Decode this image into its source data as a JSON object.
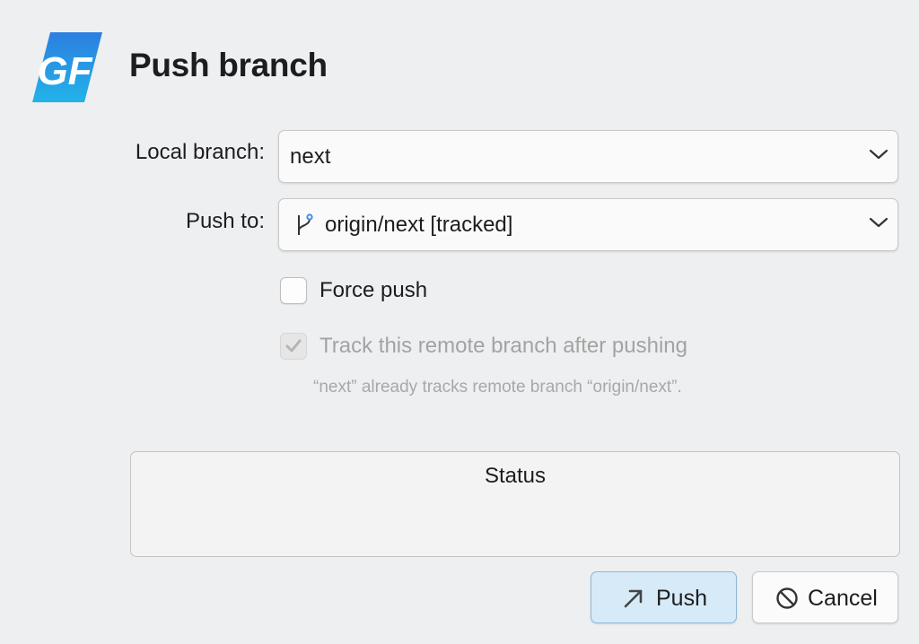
{
  "dialog": {
    "title": "Push branch",
    "logo_icon": "gitfox-logo-icon"
  },
  "form": {
    "local_branch": {
      "label": "Local branch:",
      "value": "next"
    },
    "push_to": {
      "label": "Push to:",
      "value": "origin/next [tracked]",
      "icon": "branch-icon"
    },
    "force_push": {
      "label": "Force push",
      "checked": false
    },
    "track_remote": {
      "label": "Track this remote branch after pushing",
      "checked": true,
      "enabled": false,
      "hint": "“next” already tracks remote branch “origin/next”."
    }
  },
  "status": {
    "title": "Status"
  },
  "buttons": {
    "push": "Push",
    "cancel": "Cancel"
  },
  "colors": {
    "accent": "#3a8ee6",
    "push_button_bg": "#d6eaf8",
    "window_bg": "#eeeff0"
  }
}
